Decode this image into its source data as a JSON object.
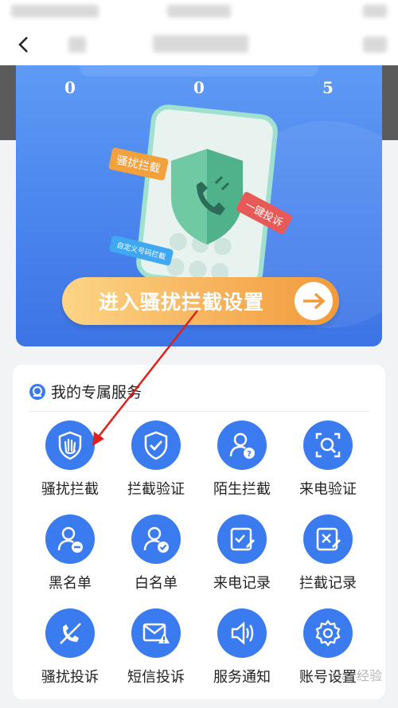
{
  "banner": {
    "stats": [
      "0",
      "0",
      "5"
    ],
    "tags": {
      "orange": "骚扰拦截",
      "red": "一键投诉",
      "blue": "自定义号码拦截"
    },
    "cta_label": "进入骚扰拦截设置"
  },
  "services": {
    "title": "我的专属服务",
    "items": [
      {
        "label": "骚扰拦截",
        "icon": "hand-stop-icon"
      },
      {
        "label": "拦截验证",
        "icon": "shield-check-icon"
      },
      {
        "label": "陌生拦截",
        "icon": "user-question-icon"
      },
      {
        "label": "来电验证",
        "icon": "scan-search-icon"
      },
      {
        "label": "黑名单",
        "icon": "user-minus-icon"
      },
      {
        "label": "白名单",
        "icon": "user-check-icon"
      },
      {
        "label": "来电记录",
        "icon": "edit-record-icon"
      },
      {
        "label": "拦截记录",
        "icon": "blocked-record-icon"
      },
      {
        "label": "骚扰投诉",
        "icon": "phone-slash-icon"
      },
      {
        "label": "短信投诉",
        "icon": "mail-warning-icon"
      },
      {
        "label": "服务通知",
        "icon": "speaker-icon"
      },
      {
        "label": "账号设置",
        "icon": "gear-icon"
      }
    ]
  },
  "watermark": "Bai 经验",
  "colors": {
    "accent": "#3a7bf0",
    "cta": "#f7b35c",
    "annotation": "#e0201c"
  }
}
